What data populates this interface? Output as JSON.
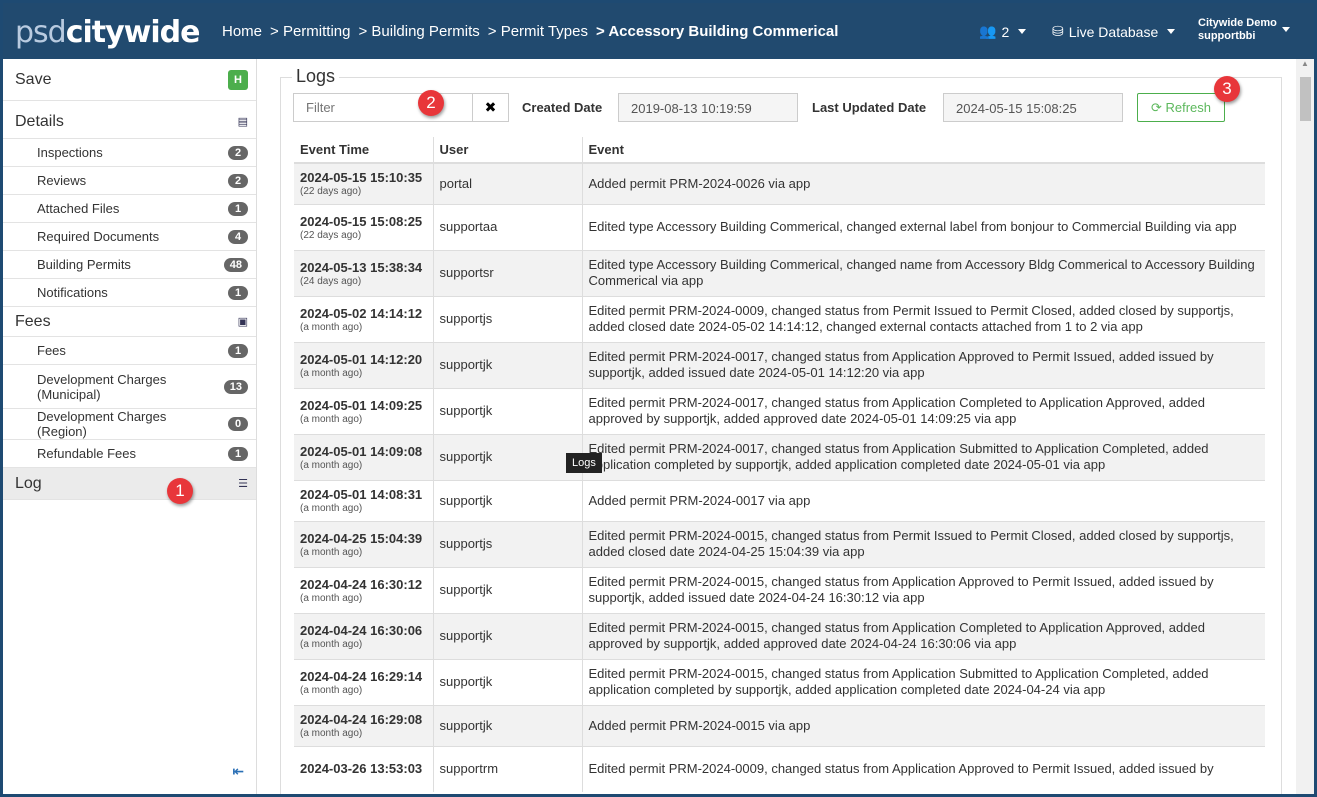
{
  "header": {
    "logo_light": "psd",
    "logo_bold": "citywide",
    "breadcrumbs": [
      "Home",
      "> Permitting",
      "> Building Permits",
      "> Permit Types"
    ],
    "current": "> Accessory Building Commerical",
    "users_count": "2",
    "database": "Live Database",
    "org": "Citywide Demo",
    "username": "supportbbi"
  },
  "sidebar": {
    "save": "Save",
    "sections": [
      {
        "label": "Details",
        "items": [
          {
            "label": "Inspections",
            "count": "2"
          },
          {
            "label": "Reviews",
            "count": "2"
          },
          {
            "label": "Attached Files",
            "count": "1"
          },
          {
            "label": "Required Documents",
            "count": "4"
          },
          {
            "label": "Building Permits",
            "count": "48"
          },
          {
            "label": "Notifications",
            "count": "1"
          }
        ]
      },
      {
        "label": "Fees",
        "items": [
          {
            "label": "Fees",
            "count": "1"
          },
          {
            "label": "Development Charges (Municipal)",
            "count": "13"
          },
          {
            "label": "Development Charges (Region)",
            "count": "0"
          },
          {
            "label": "Refundable Fees",
            "count": "1"
          }
        ]
      }
    ],
    "log": "Log"
  },
  "logs": {
    "title": "Logs",
    "filter_placeholder": "Filter",
    "created_label": "Created Date",
    "created_value": "2019-08-13 10:19:59",
    "updated_label": "Last Updated Date",
    "updated_value": "2024-05-15 15:08:25",
    "refresh": "Refresh",
    "tooltip": "Logs",
    "columns": [
      "Event Time",
      "User",
      "Event"
    ],
    "rows": [
      {
        "time": "2024-05-15 15:10:35",
        "ago": "(22 days ago)",
        "user": "portal",
        "event": "Added permit PRM-2024-0026 via app"
      },
      {
        "time": "2024-05-15 15:08:25",
        "ago": "(22 days ago)",
        "user": "supportaa",
        "event": "Edited type Accessory Building Commerical, changed external label from bonjour to Commercial Building via app"
      },
      {
        "time": "2024-05-13 15:38:34",
        "ago": "(24 days ago)",
        "user": "supportsr",
        "event": "Edited type Accessory Building Commerical, changed name from Accessory Bldg Commerical to Accessory Building Commerical via app"
      },
      {
        "time": "2024-05-02 14:14:12",
        "ago": "(a month ago)",
        "user": "supportjs",
        "event": "Edited permit PRM-2024-0009, changed status from Permit Issued to Permit Closed, added closed by supportjs, added closed date 2024-05-02 14:14:12, changed external contacts attached from 1 to 2 via app"
      },
      {
        "time": "2024-05-01 14:12:20",
        "ago": "(a month ago)",
        "user": "supportjk",
        "event": "Edited permit PRM-2024-0017, changed status from Application Approved to Permit Issued, added issued by supportjk, added issued date 2024-05-01 14:12:20 via app"
      },
      {
        "time": "2024-05-01 14:09:25",
        "ago": "(a month ago)",
        "user": "supportjk",
        "event": "Edited permit PRM-2024-0017, changed status from Application Completed to Application Approved, added approved by supportjk, added approved date 2024-05-01 14:09:25 via app"
      },
      {
        "time": "2024-05-01 14:09:08",
        "ago": "(a month ago)",
        "user": "supportjk",
        "event": "Edited permit PRM-2024-0017, changed status from Application Submitted to Application Completed, added application completed by supportjk, added application completed date 2024-05-01 via app"
      },
      {
        "time": "2024-05-01 14:08:31",
        "ago": "(a month ago)",
        "user": "supportjk",
        "event": "Added permit PRM-2024-0017 via app"
      },
      {
        "time": "2024-04-25 15:04:39",
        "ago": "(a month ago)",
        "user": "supportjs",
        "event": "Edited permit PRM-2024-0015, changed status from Permit Issued to Permit Closed, added closed by supportjs, added closed date 2024-04-25 15:04:39 via app"
      },
      {
        "time": "2024-04-24 16:30:12",
        "ago": "(a month ago)",
        "user": "supportjk",
        "event": "Edited permit PRM-2024-0015, changed status from Application Approved to Permit Issued, added issued by supportjk, added issued date 2024-04-24 16:30:12 via app"
      },
      {
        "time": "2024-04-24 16:30:06",
        "ago": "(a month ago)",
        "user": "supportjk",
        "event": "Edited permit PRM-2024-0015, changed status from Application Completed to Application Approved, added approved by supportjk, added approved date 2024-04-24 16:30:06 via app"
      },
      {
        "time": "2024-04-24 16:29:14",
        "ago": "(a month ago)",
        "user": "supportjk",
        "event": "Edited permit PRM-2024-0015, changed status from Application Submitted to Application Completed, added application completed by supportjk, added application completed date 2024-04-24 via app"
      },
      {
        "time": "2024-04-24 16:29:08",
        "ago": "(a month ago)",
        "user": "supportjk",
        "event": "Added permit PRM-2024-0015 via app"
      },
      {
        "time": "2024-03-26 13:53:03",
        "ago": "",
        "user": "supportrm",
        "event": "Edited permit PRM-2024-0009, changed status from Application Approved to Permit Issued, added issued by"
      }
    ]
  },
  "markers": [
    "1",
    "2",
    "3"
  ],
  "colors": {
    "header": "#214a6f",
    "save": "#4cae4c",
    "marker": "#e8363a"
  }
}
